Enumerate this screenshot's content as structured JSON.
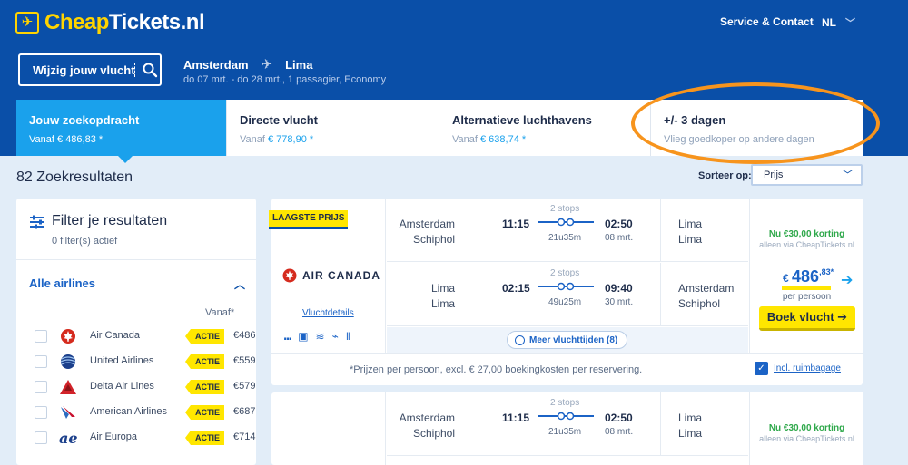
{
  "brand": {
    "prefix": "Cheap",
    "suffix": "Tickets.nl",
    "accent": "#ffd400",
    "header_bg": "#0a4fa8",
    "active_tab": "#1aa1ec"
  },
  "header": {
    "service": "Service & Contact",
    "lang": "NL"
  },
  "search": {
    "modify_label": "Wijzig jouw vlucht",
    "origin": "Amsterdam",
    "destination": "Lima",
    "summary": "do 07 mrt. - do 28 mrt., 1 passagier, Economy"
  },
  "tabs": [
    {
      "title": "Jouw zoekopdracht",
      "prefix": "Vanaf ",
      "price": "€ 486,83 *"
    },
    {
      "title": "Directe vlucht",
      "prefix": "Vanaf ",
      "price": "€ 778,90 *"
    },
    {
      "title": "Alternatieve luchthavens",
      "prefix": "Vanaf ",
      "price": "€ 638,74 *"
    },
    {
      "title": "+/- 3 dagen",
      "subtitle": "Vlieg goedkoper op andere dagen"
    }
  ],
  "results": {
    "count": "82 Zoekresultaten",
    "sort_label": "Sorteer op:",
    "sort_value": "Prijs"
  },
  "filter": {
    "title": "Filter je resultaten",
    "active": "0 filter(s) actief",
    "airlines_title": "Alle airlines",
    "vanaf": "Vanaf*",
    "airlines": [
      {
        "name": "Air Canada",
        "tag": "ACTIE",
        "price": "€486"
      },
      {
        "name": "United Airlines",
        "tag": "ACTIE",
        "price": "€559"
      },
      {
        "name": "Delta Air Lines",
        "tag": "ACTIE",
        "price": "€579"
      },
      {
        "name": "American Airlines",
        "tag": "ACTIE",
        "price": "€687"
      },
      {
        "name": "Air Europa",
        "tag": "ACTIE",
        "price": "€714"
      }
    ]
  },
  "card1": {
    "badge": "LAAGSTE PRIJS",
    "airline": "AIR CANADA",
    "details": "Vluchtdetails",
    "legs": [
      {
        "from": "Amsterdam",
        "from_sub": "Schiphol",
        "dep": "11:15",
        "stops": "2 stops",
        "duration": "21u35m",
        "arr": "02:50",
        "date": "08 mrt.",
        "to": "Lima",
        "to_sub": "Lima"
      },
      {
        "from": "Lima",
        "from_sub": "Lima",
        "dep": "02:15",
        "stops": "2 stops",
        "duration": "49u25m",
        "arr": "09:40",
        "date": "30 mrt.",
        "to": "Amsterdam",
        "to_sub": "Schiphol"
      }
    ],
    "more_times": "Meer vluchttijden (8)",
    "discount": "Nu €30,00 korting",
    "discount_sub": "alleen via CheapTickets.nl",
    "price_cur": "€ ",
    "price_int": "486",
    "price_dec": ",83*",
    "per_person": "per persoon",
    "book": "Boek vlucht ➔",
    "footnote": "*Prijzen per persoon, excl. € 27,00 boekingkosten per reservering.",
    "baggage": "Incl. ruimbagage"
  },
  "card2": {
    "leg": {
      "from": "Amsterdam",
      "from_sub": "Schiphol",
      "dep": "11:15",
      "stops": "2 stops",
      "duration": "21u35m",
      "arr": "02:50",
      "date": "08 mrt.",
      "to": "Lima",
      "to_sub": "Lima"
    },
    "discount": "Nu €30,00 korting",
    "discount_sub": "alleen via CheapTickets.nl"
  }
}
